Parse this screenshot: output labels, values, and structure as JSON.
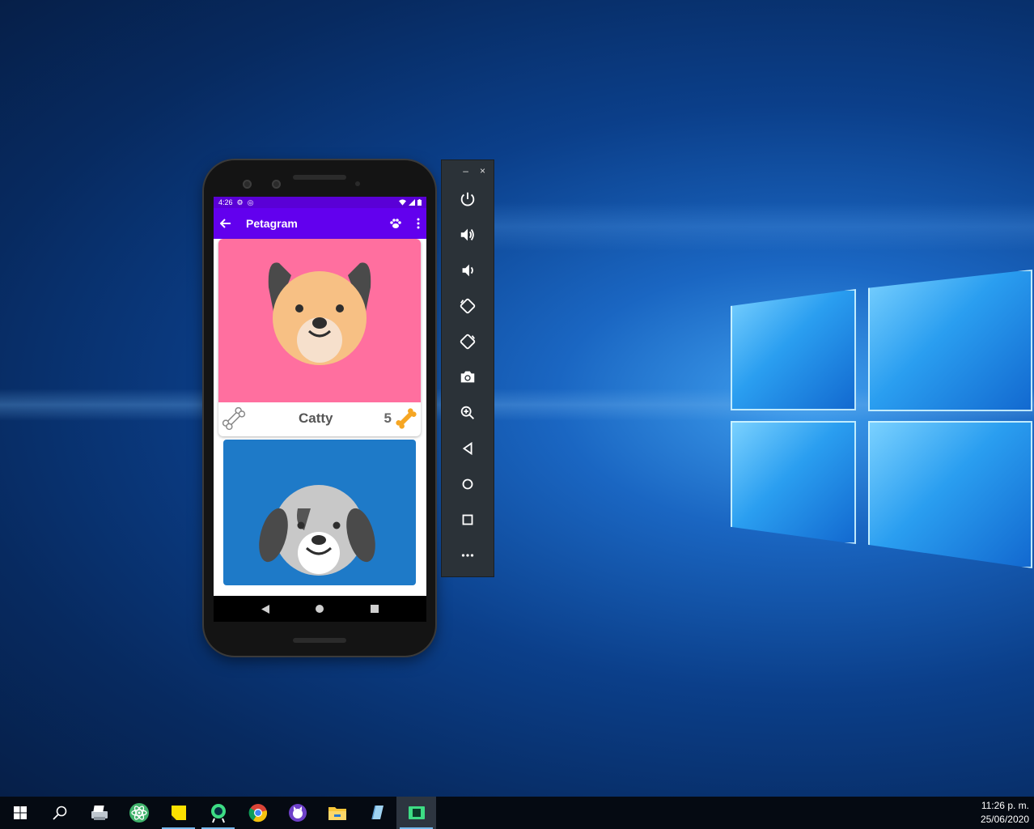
{
  "desktop": {
    "accent_color": "#0b3f8a"
  },
  "phone": {
    "status_bar": {
      "time": "4:26"
    },
    "app_bar": {
      "title": "Petagram",
      "back_icon": "arrow-left-icon",
      "action_icon": "paw-icon",
      "menu_icon": "more-vert-icon"
    },
    "cards": [
      {
        "name": "Catty",
        "likes": "5",
        "background_color": "#ff6f9f",
        "pet_image": "tan-dog-face"
      },
      {
        "name": "",
        "background_color": "#1e7ac8",
        "pet_image": "gray-dog-face"
      }
    ],
    "nav_bar": [
      "back-icon",
      "home-icon",
      "recents-icon"
    ]
  },
  "emulator_toolbar": {
    "window_buttons": [
      "–",
      "×"
    ],
    "buttons": [
      "power-icon",
      "volume-up-icon",
      "volume-down-icon",
      "rotate-left-icon",
      "rotate-right-icon",
      "camera-icon",
      "zoom-icon",
      "back-icon",
      "home-icon",
      "overview-icon",
      "more-icon"
    ]
  },
  "taskbar": {
    "apps": [
      "windows-start-icon",
      "search-icon",
      "printer-icon",
      "atom-icon",
      "sticky-notes-icon",
      "android-studio-icon",
      "chrome-icon",
      "github-desktop-icon",
      "file-explorer-icon",
      "snipping-icon",
      "emulator-icon"
    ],
    "clock_time": "11:26 p. m.",
    "clock_date": "25/06/2020"
  }
}
